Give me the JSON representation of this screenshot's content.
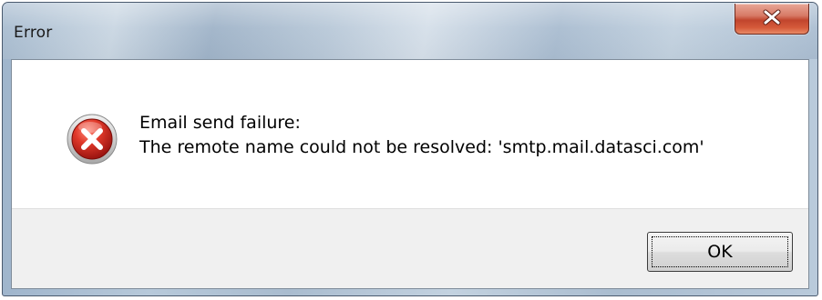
{
  "window": {
    "title": "Error"
  },
  "titlebar": {
    "close_icon": "close-x-icon",
    "close_color": "#c1452d"
  },
  "dialog": {
    "icon": "error-icon",
    "icon_color": "#d32f2f",
    "message_line1": "Email send failure:",
    "message_line2": "The remote name could not be resolved: 'smtp.mail.datasci.com'"
  },
  "buttons": {
    "ok_label": "OK"
  }
}
